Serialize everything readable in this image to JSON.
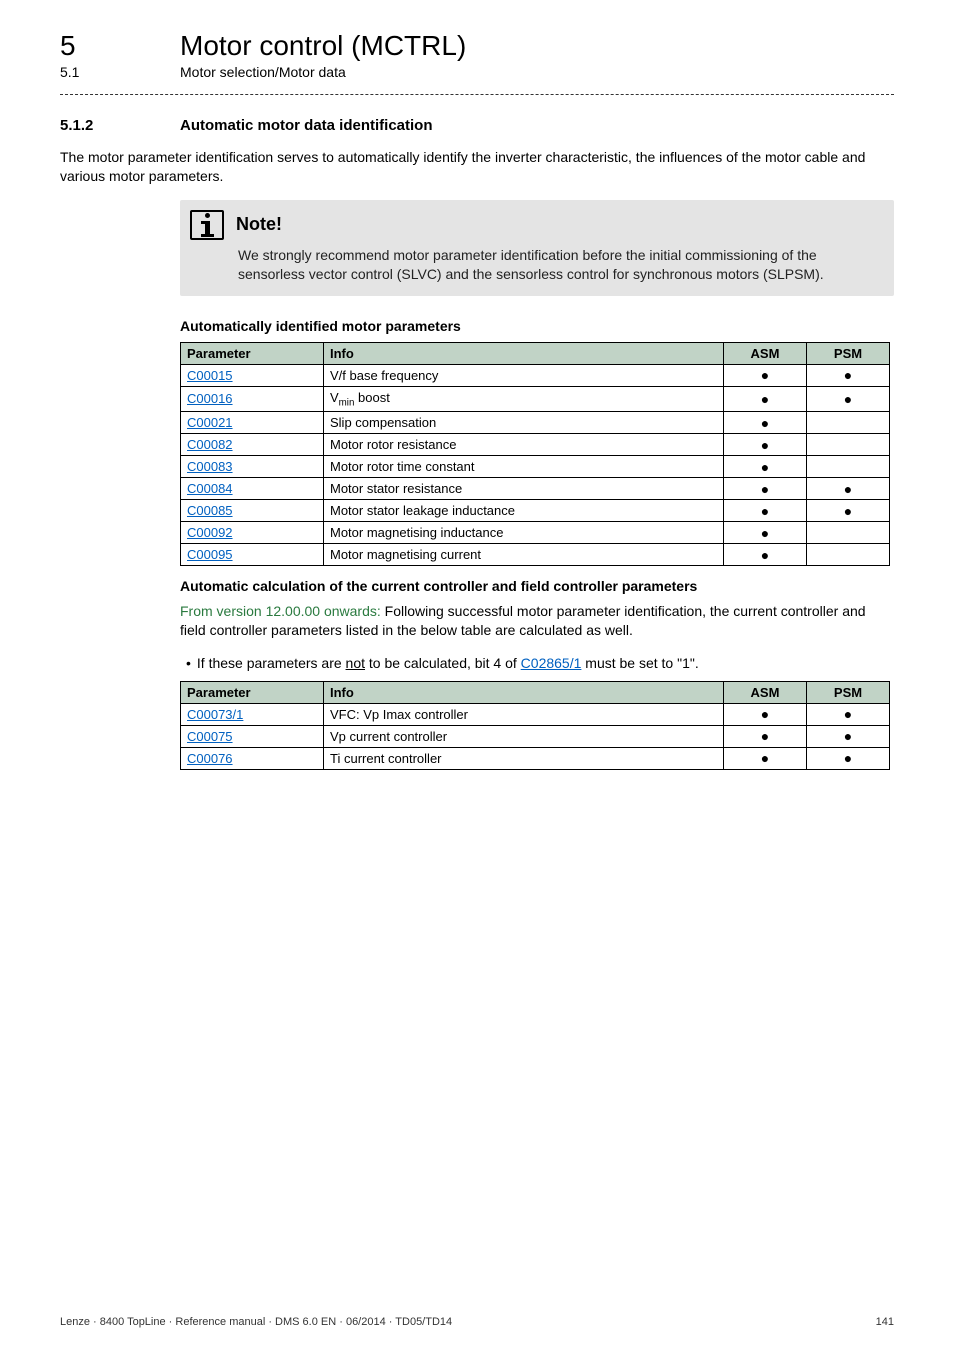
{
  "header": {
    "chapter_num": "5",
    "chapter_title": "Motor control (MCTRL)",
    "section_num": "5.1",
    "section_title": "Motor selection/Motor data"
  },
  "subsection": {
    "num": "5.1.2",
    "title": "Automatic  motor data identification"
  },
  "intro_para": "The motor parameter identification serves to automatically identify the inverter characteristic, the influences of the motor cable and various motor parameters.",
  "note": {
    "title": "Note!",
    "text": "We strongly recommend motor parameter identification before the initial commissioning of the sensorless vector control (SLVC) and the sensorless control for synchronous motors (SLPSM)."
  },
  "section_a": {
    "heading": "Automatically identified motor parameters",
    "columns": {
      "param": "Parameter",
      "info": "Info",
      "asm": "ASM",
      "psm": "PSM"
    },
    "rows": [
      {
        "param": "C00015",
        "info_html": "V/f base frequency",
        "asm": "●",
        "psm": "●"
      },
      {
        "param": "C00016",
        "info_html": "V<sub>min</sub> boost",
        "asm": "●",
        "psm": "●"
      },
      {
        "param": "C00021",
        "info_html": "Slip compensation",
        "asm": "●",
        "psm": ""
      },
      {
        "param": "C00082",
        "info_html": "Motor rotor resistance",
        "asm": "●",
        "psm": ""
      },
      {
        "param": "C00083",
        "info_html": "Motor rotor time constant",
        "asm": "●",
        "psm": ""
      },
      {
        "param": "C00084",
        "info_html": "Motor stator resistance",
        "asm": "●",
        "psm": "●"
      },
      {
        "param": "C00085",
        "info_html": "Motor stator leakage inductance",
        "asm": "●",
        "psm": "●"
      },
      {
        "param": "C00092",
        "info_html": "Motor magnetising inductance",
        "asm": "●",
        "psm": ""
      },
      {
        "param": "C00095",
        "info_html": "Motor magnetising current",
        "asm": "●",
        "psm": ""
      }
    ]
  },
  "section_b": {
    "heading": "Automatic calculation of the current controller and field controller parameters",
    "lead_prefix": "From version 12.00.00 onwards:",
    "lead_rest": " Following successful motor parameter identification, the current controller and field controller parameters listed in the below table are calculated as well.",
    "bullet_pre": "If these parameters are ",
    "bullet_not": "not",
    "bullet_mid": " to be calculated, bit 4 of ",
    "bullet_link": "C02865/1",
    "bullet_post": " must be set to \"1\".",
    "columns": {
      "param": "Parameter",
      "info": "Info",
      "asm": "ASM",
      "psm": "PSM"
    },
    "rows": [
      {
        "param": "C00073/1",
        "info_html": "VFC: Vp Imax controller",
        "asm": "●",
        "psm": "●"
      },
      {
        "param": "C00075",
        "info_html": "Vp current controller",
        "asm": "●",
        "psm": "●"
      },
      {
        "param": "C00076",
        "info_html": "Ti current controller",
        "asm": "●",
        "psm": "●"
      }
    ]
  },
  "footer": {
    "left": "Lenze · 8400 TopLine · Reference manual · DMS 6.0 EN · 06/2014 · TD05/TD14",
    "right": "141"
  }
}
